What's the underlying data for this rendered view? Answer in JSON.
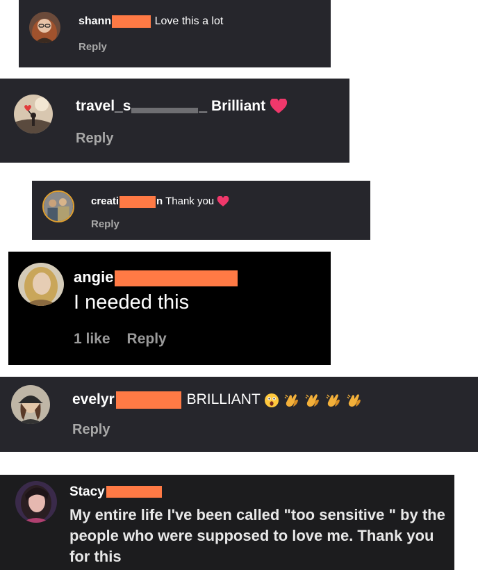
{
  "comments": [
    {
      "username": "shann",
      "text": "Love this a lot",
      "reply_label": "Reply",
      "avatar_icon": "avatar-woman-glasses"
    },
    {
      "username": "travel_s",
      "username_suffix": "_",
      "text": "Brilliant",
      "emoji": [
        "red-heart-icon"
      ],
      "reply_label": "Reply",
      "avatar_icon": "avatar-silhouette-heart-balloon"
    },
    {
      "username": "creati",
      "username_suffix": "n",
      "text": "Thank you",
      "emoji": [
        "red-heart-icon"
      ],
      "reply_label": "Reply",
      "avatar_icon": "avatar-group-photo"
    },
    {
      "username": "angie",
      "text": "I needed this",
      "likes_label": "1 like",
      "reply_label": "Reply",
      "avatar_icon": "avatar-blonde-woman"
    },
    {
      "username": "evelyr",
      "text": "BRILLIANT",
      "emoji": [
        "astonished-face-icon",
        "clapping-hands-icon",
        "clapping-hands-icon",
        "clapping-hands-icon",
        "clapping-hands-icon"
      ],
      "reply_label": "Reply",
      "avatar_icon": "avatar-woman-cap"
    },
    {
      "username": "Stacy",
      "text": "My entire life I've been called \"too sensitive \" by the people who were supposed to love me. Thank you for this",
      "avatar_icon": "avatar-dark-hair-woman"
    }
  ],
  "colors": {
    "card_bg": "#26262c",
    "card_bg_black": "#000000",
    "card_bg_dark": "#1c1c1e",
    "redaction": "#ff7a45",
    "meta_text": "#a8a8a8",
    "heart": "#f0386b"
  }
}
